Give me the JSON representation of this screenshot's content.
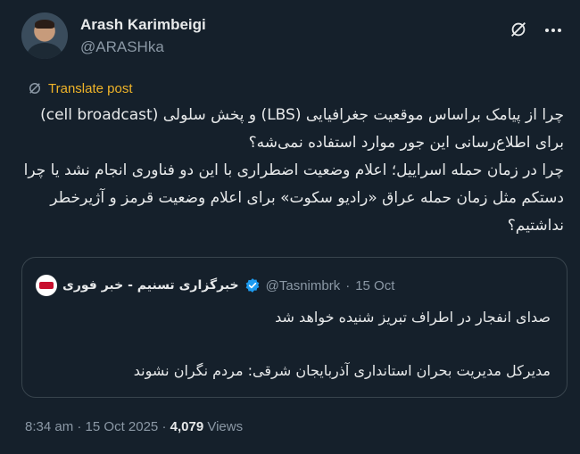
{
  "author": {
    "name": "Arash Karimbeigi",
    "handle": "@ARASHka"
  },
  "translate_label": "Translate post",
  "tweet_text": "چرا از پیامک براساس موقعیت جغرافیایی (LBS) و پخش سلولی (cell broadcast) برای اطلاع‌رسانی این جور موارد استفاده نمی‌شه؟\nچرا در زمان حمله اسراییل؛ اعلام وضعیت اضطراری با این دو فناوری انجام نشد یا چرا دستکم مثل زمان حمله عراق «رادیو سکوت» برای اعلام وضعیت قرمز و آژیرخطر نداشتیم؟",
  "quote": {
    "name": "خبرگزاری تسنیم - خبر فوری",
    "handle": "@Tasnimbrk",
    "separator": "·",
    "date": "15 Oct",
    "text": "صدای انفجار در اطراف تبریز شنیده خواهد شد\n\nمدیرکل مدیریت بحران استانداری آذربایجان شرقی: مردم نگران نشوند"
  },
  "footer": {
    "time": "8:34 am",
    "dot1": "·",
    "date": "15 Oct 2025",
    "dot2": "·",
    "views_count": "4,079",
    "views_label": "Views"
  },
  "colors": {
    "background": "#15202b",
    "text": "#e7e9ea",
    "muted": "#8b98a5",
    "translate": "#f0b429",
    "verified": "#1d9bf0",
    "border": "#38444d"
  },
  "icons": {
    "grok": "grok-icon",
    "more": "more-icon",
    "translate": "translate-icon",
    "verified": "verified-badge-icon"
  }
}
